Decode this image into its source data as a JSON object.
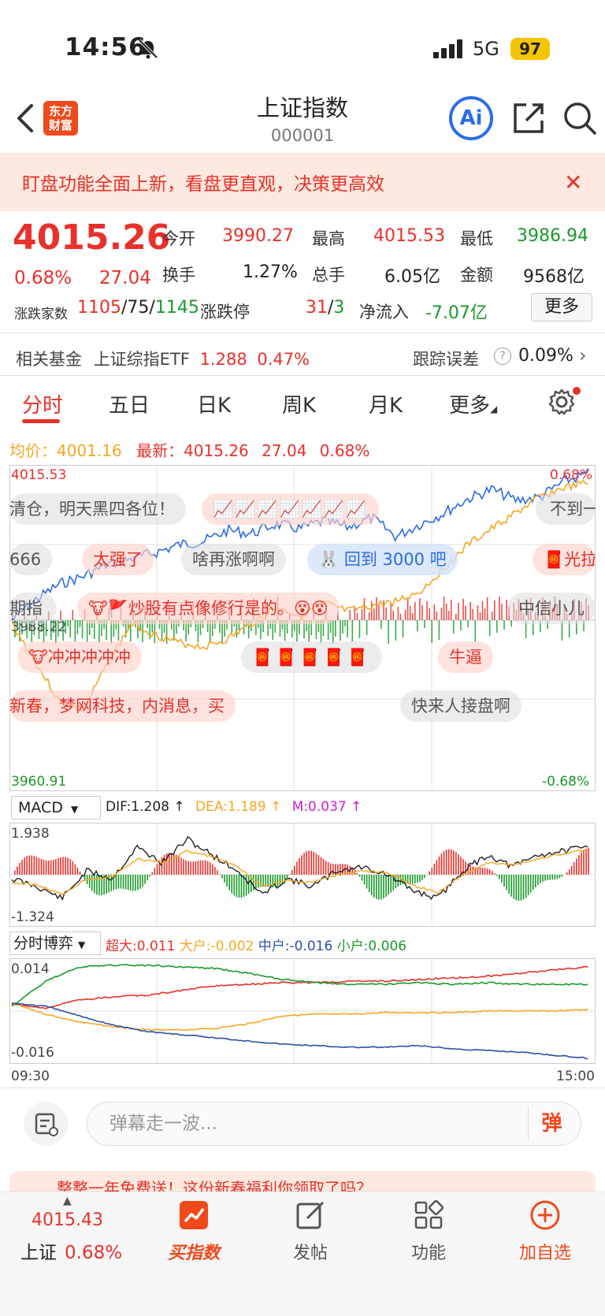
{
  "status": {
    "time": "14:56",
    "network": "5G",
    "battery": "97"
  },
  "header": {
    "logo": "东方财富",
    "title": "上证指数",
    "code": "000001"
  },
  "banner": {
    "text": "盯盘功能全面上新，看盘更直观，决策更高效"
  },
  "quote": {
    "price": "4015.26",
    "pct": "0.68%",
    "change": "27.04",
    "open_label": "今开",
    "open": "3990.27",
    "high_label": "最高",
    "high": "4015.53",
    "low_label": "最低",
    "low": "3986.94",
    "turnover_label": "换手",
    "turnover": "1.27%",
    "volume_label": "总手",
    "volume": "6.05亿",
    "amount_label": "金额",
    "amount": "9568亿",
    "breadth_label": "涨跌家数",
    "breadth_up": "1105",
    "breadth_flat": "75",
    "breadth_down": "1145",
    "limit_label": "涨跌停",
    "limit_up": "31",
    "limit_down": "3",
    "inflow_label": "净流入",
    "inflow": "-7.07亿",
    "more": "更多"
  },
  "fund": {
    "label": "相关基金",
    "name": "上证综指ETF",
    "price": "1.288",
    "pct": "0.47%",
    "err_label": "跟踪误差",
    "err": "0.09%"
  },
  "tabs": [
    "分时",
    "五日",
    "日K",
    "周K",
    "月K",
    "更多"
  ],
  "chart_info": {
    "avg_label": "均价：",
    "avg": "4001.16",
    "last_label": "最新：",
    "last": "4015.26",
    "chg": "27.04",
    "pct": "0.68%"
  },
  "chart_labels": {
    "y_top": "4015.53",
    "y_mid": "3988.22",
    "y_bottom": "3960.91",
    "pct_top": "0.68%",
    "pct_bottom": "-0.68%",
    "time_start": "09:30",
    "time_end": "15:00"
  },
  "danmu": [
    "清仓，明天黑四各位！",
    "不到一",
    "666",
    "太强了",
    "啥再涨啊啊",
    "回到 3000 吧",
    "光拉",
    "期指",
    "炒股有点像修行是的。",
    "中信小儿",
    "冲冲冲冲冲",
    "牛逼",
    "新春，梦网科技，内消息，买",
    "快来人接盘啊"
  ],
  "macd": {
    "select": "MACD",
    "dif": "DIF:1.208 ↑",
    "dea": "DEA:1.189 ↑",
    "m": "M:0.037 ↑",
    "y_top": "1.938",
    "y_bottom": "-1.324"
  },
  "bo": {
    "select": "分时博弈",
    "super": "超大:0.011",
    "large": "大户:-0.002",
    "mid": "中户:-0.016",
    "small": "小户:0.006",
    "y_top": "0.014",
    "y_bottom": "-0.016"
  },
  "comment": {
    "placeholder": "弹幕走一波...",
    "send": "弹"
  },
  "promo": {
    "text": "整整一年免费送！这份新春福利你领取了吗？"
  },
  "bottom_nav": {
    "price": "4015.43",
    "name": "上证",
    "pct": "0.68%",
    "items": [
      "买指数",
      "发帖",
      "功能",
      "加自选"
    ]
  },
  "colors": {
    "accent": "#e8312a",
    "green": "#1a9a2a",
    "price_line": "#2b6ce8",
    "avg_line": "#f5a623"
  }
}
